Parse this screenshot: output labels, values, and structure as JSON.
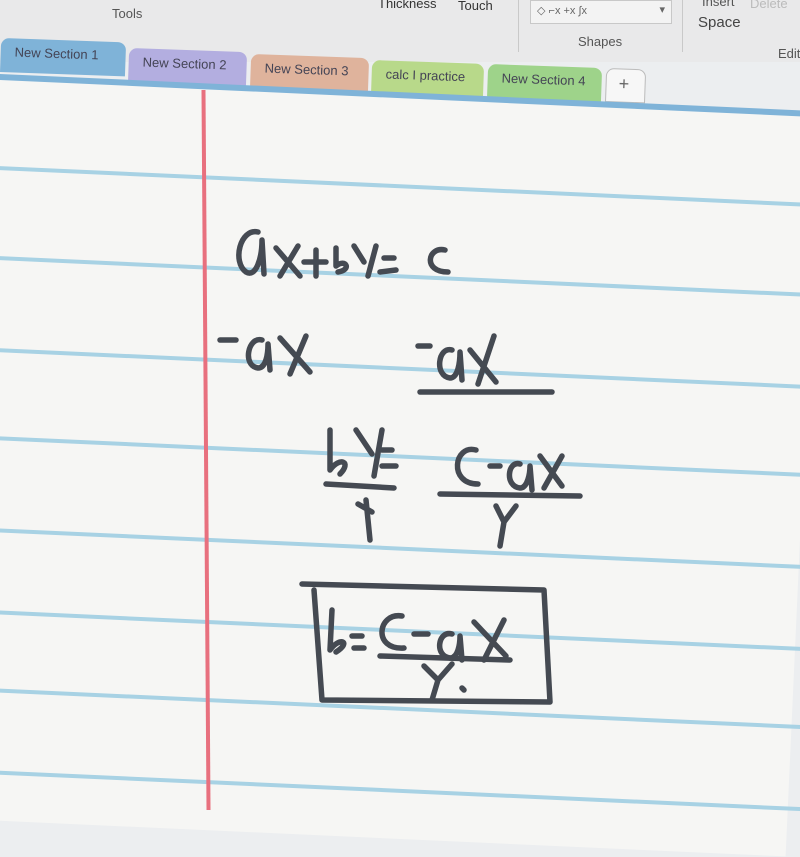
{
  "ribbon": {
    "groups": {
      "tools": "Tools",
      "thickness": "Thickness",
      "touch": "Touch",
      "shapes": "Shapes",
      "insert": "Insert",
      "delete": "Delete",
      "space": "Space",
      "edit": "Edit"
    },
    "shape_glyphs": "◇ ⌐x +x ∫x",
    "more_shapes": "▾"
  },
  "section_tabs": [
    {
      "label": "New Section 1",
      "color": "#7fb3d8",
      "active": true
    },
    {
      "label": "New Section 2",
      "color": "#b3aee0"
    },
    {
      "label": "New Section 3",
      "color": "#dfb39c"
    },
    {
      "label": "calc I practice",
      "color": "#b8d98a"
    },
    {
      "label": "New Section 4",
      "color": "#9ed38a"
    }
  ],
  "add_tab_label": "+",
  "handwriting": {
    "line1": "ax+by=c",
    "line2_left": "-ax",
    "line2_right": "-ax",
    "line3": "by/y = (c-ax)/y",
    "answer": "b = (c-ax)/y."
  },
  "colors": {
    "ink": "#454a52",
    "margin_line": "#e8707e",
    "rule_line": "#a8d2e4"
  }
}
